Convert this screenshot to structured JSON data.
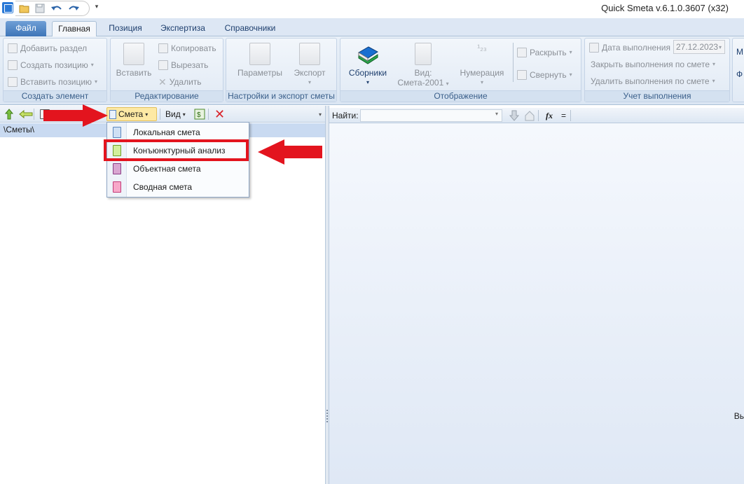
{
  "window": {
    "title": "Quick Smeta v.6.1.0.3607 (x32)"
  },
  "tabs": [
    {
      "label": "Файл"
    },
    {
      "label": "Главная"
    },
    {
      "label": "Позиция"
    },
    {
      "label": "Экспертиза"
    },
    {
      "label": "Справочники"
    }
  ],
  "ribbon": {
    "create": {
      "label": "Создать элемент",
      "add_section": "Добавить раздел",
      "create_position": "Создать позицию",
      "insert_position": "Вставить позицию"
    },
    "edit": {
      "label": "Редактирование",
      "paste": "Вставить",
      "copy": "Копировать",
      "cut": "Вырезать",
      "delete": "Удалить"
    },
    "settings": {
      "label": "Настройки и экспорт сметы",
      "params": "Параметры",
      "export": "Экспорт"
    },
    "display": {
      "label": "Отображение",
      "collections": "Сборники",
      "view_line1": "Вид:",
      "view_line2": "Смета-2001",
      "numbering": "Нумерация",
      "expand": "Раскрыть",
      "collapse": "Свернуть"
    },
    "progress": {
      "label": "Учет выполнения",
      "date_label": "Дата выполнения",
      "date_value": "27.12.2023",
      "close": "Закрыть выполнения по смете",
      "remove": "Удалить выполнения по смете"
    },
    "edge_1": "М",
    "edge_2": "Ф"
  },
  "left_toolbar": {
    "smeta": "Смета",
    "view": "Вид"
  },
  "path": "\\Сметы\\",
  "search": {
    "label": "Найти:",
    "fx": "fx",
    "eq": "="
  },
  "right_edge_text": "Вь",
  "menu": [
    {
      "label": "Локальная смета",
      "color": "#cfe0f4",
      "border": "#5b87bf"
    },
    {
      "label": "Конъюнктурный анализ",
      "color": "#d2ef9b",
      "border": "#6f9f2a"
    },
    {
      "label": "Объектная смета",
      "color": "#d9a6d1",
      "border": "#8b3f86"
    },
    {
      "label": "Сводная смета",
      "color": "#f7a8c9",
      "border": "#c23b78"
    }
  ]
}
